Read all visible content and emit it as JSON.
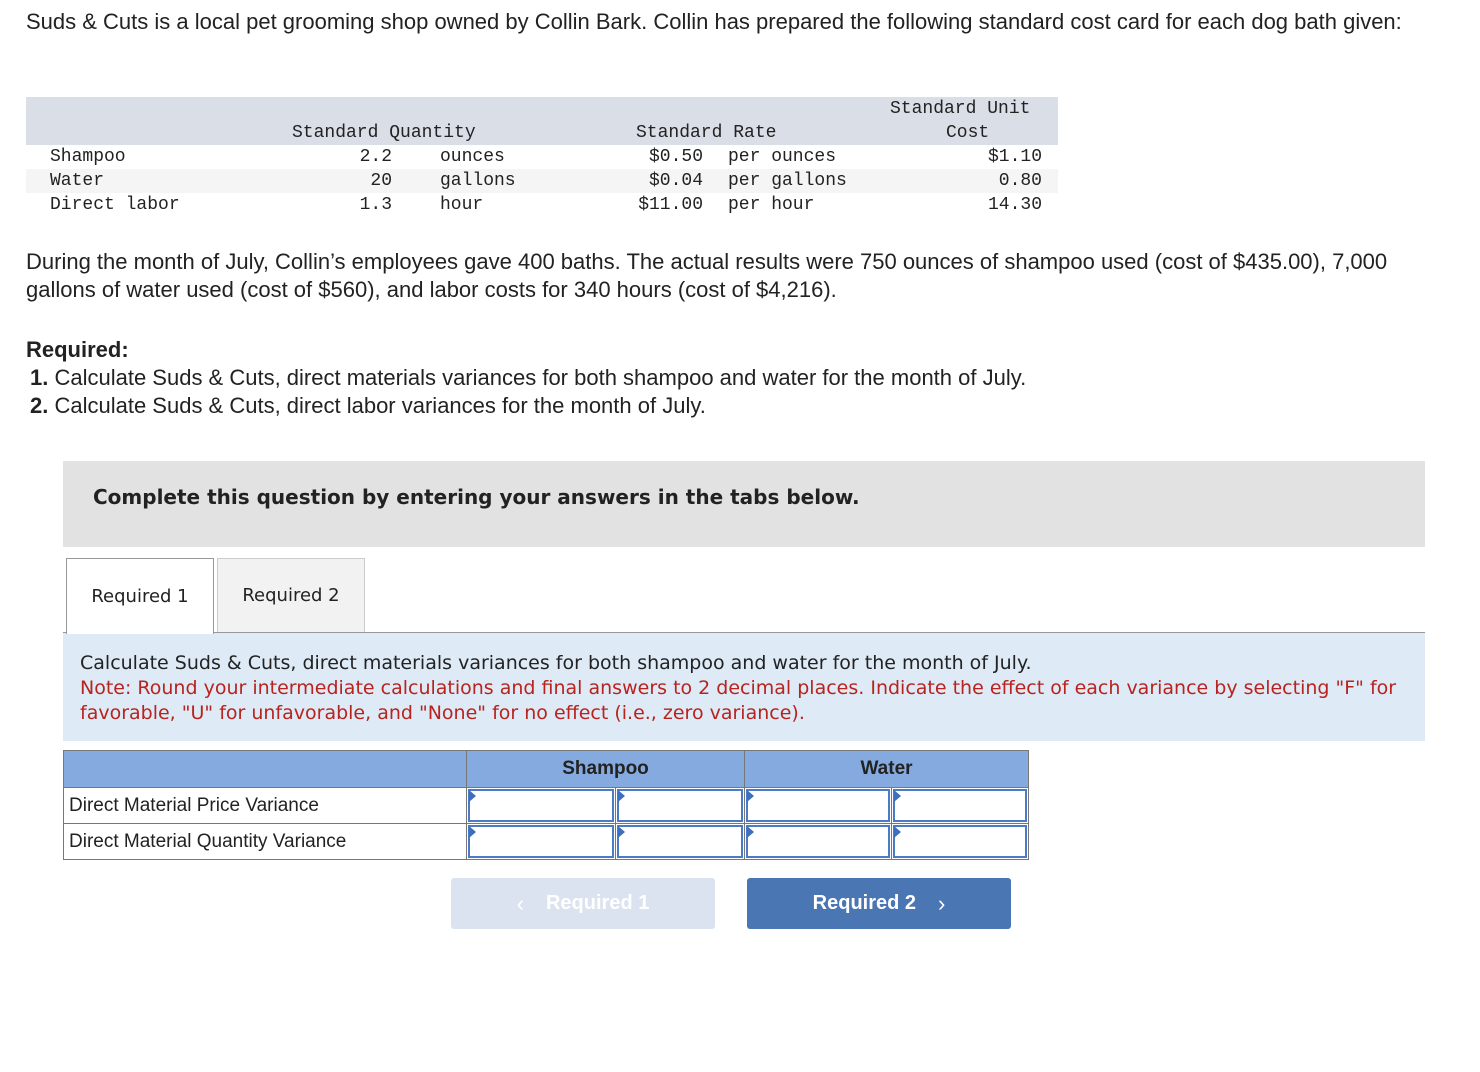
{
  "intro_text": "Suds & Cuts is a local pet grooming shop owned by Collin Bark. Collin has prepared the following standard cost card for each dog bath given:",
  "cost_card": {
    "headers": {
      "standard_quantity": "Standard Quantity",
      "standard_rate": "Standard Rate",
      "standard_unit_cost_line1": "Standard Unit",
      "standard_unit_cost_line2": "Cost"
    },
    "rows": [
      {
        "item": "Shampoo",
        "quantity": "2.2",
        "unit": "ounces",
        "rate": "$0.50",
        "rate_unit": "per ounces",
        "unit_cost": "$1.10"
      },
      {
        "item": "Water",
        "quantity": "20",
        "unit": "gallons",
        "rate": "$0.04",
        "rate_unit": "per gallons",
        "unit_cost": "0.80"
      },
      {
        "item": "Direct labor",
        "quantity": "1.3",
        "unit": "hour",
        "rate": "$11.00",
        "rate_unit": "per hour",
        "unit_cost": "14.30"
      }
    ]
  },
  "july_text": "During the month of July, Collin’s employees gave 400 baths. The actual results were 750 ounces of shampoo used (cost of $435.00), 7,000 gallons of water used (cost of $560), and labor costs for 340 hours (cost of $4,216).",
  "required": {
    "heading": "Required:",
    "items": [
      {
        "num": "1.",
        "text": " Calculate Suds & Cuts, direct materials variances for both shampoo and water for the month of July."
      },
      {
        "num": "2.",
        "text": " Calculate Suds & Cuts, direct labor variances for the month of July."
      }
    ]
  },
  "instructions": "Complete this question by entering your answers in the tabs below.",
  "tabs": [
    {
      "label": "Required 1",
      "active": true
    },
    {
      "label": "Required 2",
      "active": false
    }
  ],
  "question": {
    "prompt": "Calculate Suds & Cuts, direct materials variances for both shampoo and water for the month of July.",
    "note": "Note: Round your intermediate calculations and final answers to 2 decimal places. Indicate the effect of each variance by selecting \"F\" for favorable, \"U\" for unfavorable, and \"None\" for no effect (i.e., zero variance)."
  },
  "answer_table": {
    "columns": [
      "",
      "Shampoo",
      "Water"
    ],
    "rows": [
      {
        "label": "Direct Material Price Variance",
        "shampoo_amount": "",
        "shampoo_effect": "",
        "water_amount": "",
        "water_effect": ""
      },
      {
        "label": "Direct Material Quantity Variance",
        "shampoo_amount": "",
        "shampoo_effect": "",
        "water_amount": "",
        "water_effect": ""
      }
    ]
  },
  "nav": {
    "prev_label": "Required 1",
    "next_label": "Required 2",
    "prev_icon": "‹",
    "next_icon": "›"
  }
}
